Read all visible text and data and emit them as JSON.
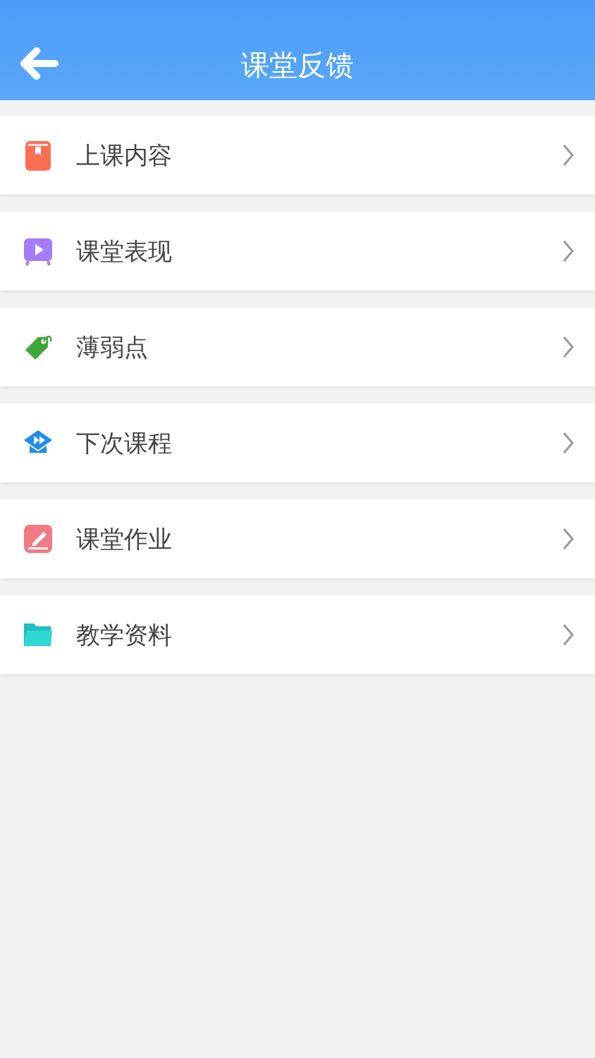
{
  "header": {
    "title": "课堂反馈"
  },
  "items": [
    {
      "kind": "book",
      "label": "上课内容"
    },
    {
      "kind": "video",
      "label": "课堂表现"
    },
    {
      "kind": "tag",
      "label": "薄弱点"
    },
    {
      "kind": "course",
      "label": "下次课程"
    },
    {
      "kind": "homework",
      "label": "课堂作业"
    },
    {
      "kind": "folder",
      "label": "教学资料"
    }
  ]
}
